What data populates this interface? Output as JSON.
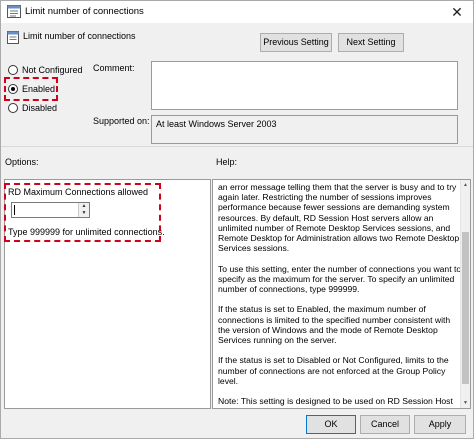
{
  "window": {
    "title": "Limit number of connections",
    "close_glyph": "✕"
  },
  "header": {
    "setting_name": "Limit number of connections",
    "previous_label": "Previous Setting",
    "next_label": "Next Setting"
  },
  "state": {
    "not_configured": "Not Configured",
    "enabled": "Enabled",
    "disabled": "Disabled",
    "selected": "Enabled"
  },
  "comment": {
    "label": "Comment:",
    "value": ""
  },
  "supported": {
    "label": "Supported on:",
    "value": "At least Windows Server 2003"
  },
  "options": {
    "label": "Options:",
    "max_connections_label": "RD Maximum Connections allowed",
    "max_connections_value": "",
    "hint": "Type 999999 for unlimited connections."
  },
  "help": {
    "label": "Help:",
    "text": "an error message telling them that the server is busy and to try again later. Restricting the number of sessions improves performance because fewer sessions are demanding system resources. By default, RD Session Host servers allow an unlimited number of Remote Desktop Services sessions, and Remote Desktop for Administration allows two Remote Desktop Services sessions.\n\nTo use this setting, enter the number of connections you want to specify as the maximum for the server. To specify an unlimited number of connections, type 999999.\n\nIf the status is set to Enabled, the maximum number of connections is limited to the specified number consistent with the version of Windows and the mode of Remote Desktop Services running on the server.\n\nIf the status is set to Disabled or Not Configured, limits to the number of connections are not enforced at the Group Policy level.\n\nNote: This setting is designed to be used on RD Session Host"
  },
  "footer": {
    "ok": "OK",
    "cancel": "Cancel",
    "apply": "Apply"
  },
  "colors": {
    "highlight": "#d0021b",
    "accent": "#0078d7"
  },
  "icons": {
    "window": "policy-setting-icon",
    "setting": "policy-setting-icon",
    "close": "close-icon"
  }
}
